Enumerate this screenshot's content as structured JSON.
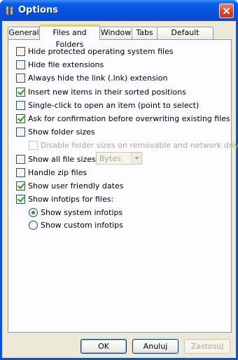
{
  "window": {
    "title": "Options"
  },
  "tabs": [
    {
      "label": "General"
    },
    {
      "label": "Files and Folders"
    },
    {
      "label": "Window"
    },
    {
      "label": "Tabs"
    },
    {
      "label": "Default Settings"
    }
  ],
  "options": {
    "hide_protected": {
      "label": "Hide protected operating system files",
      "checked": false
    },
    "hide_extensions": {
      "label": "Hide file extensions",
      "checked": false
    },
    "hide_lnk": {
      "label": "Always hide the link (.lnk) extension",
      "checked": false
    },
    "insert_sorted": {
      "label": "Insert new items in their sorted positions",
      "checked": true
    },
    "single_click": {
      "label": "Single-click to open an item (point to select)",
      "checked": false
    },
    "confirm_overwrite": {
      "label": "Ask for confirmation before overwriting existing files",
      "checked": true
    },
    "show_folder_sizes": {
      "label": "Show folder sizes",
      "checked": false
    },
    "disable_folder_sizes": {
      "label": "Disable folder sizes on removable and network drives",
      "checked": false
    },
    "show_all_sizes": {
      "label": "Show all file sizes in:",
      "checked": false
    },
    "size_unit": {
      "value": "Bytes"
    },
    "handle_zip": {
      "label": "Handle zip files",
      "checked": false
    },
    "friendly_dates": {
      "label": "Show user friendly dates",
      "checked": true
    },
    "show_infotips": {
      "label": "Show infotips for files:",
      "checked": true
    },
    "system_infotips": {
      "label": "Show system infotips",
      "selected": true
    },
    "custom_infotips": {
      "label": "Show custom infotips",
      "selected": false
    }
  },
  "buttons": {
    "ok": "OK",
    "cancel": "Anuluj",
    "apply": "Zastosuj"
  },
  "colors": {
    "title_bar": "#0651e0",
    "check_mark": "#21a121",
    "active_tab_accent": "#ffc83c"
  }
}
